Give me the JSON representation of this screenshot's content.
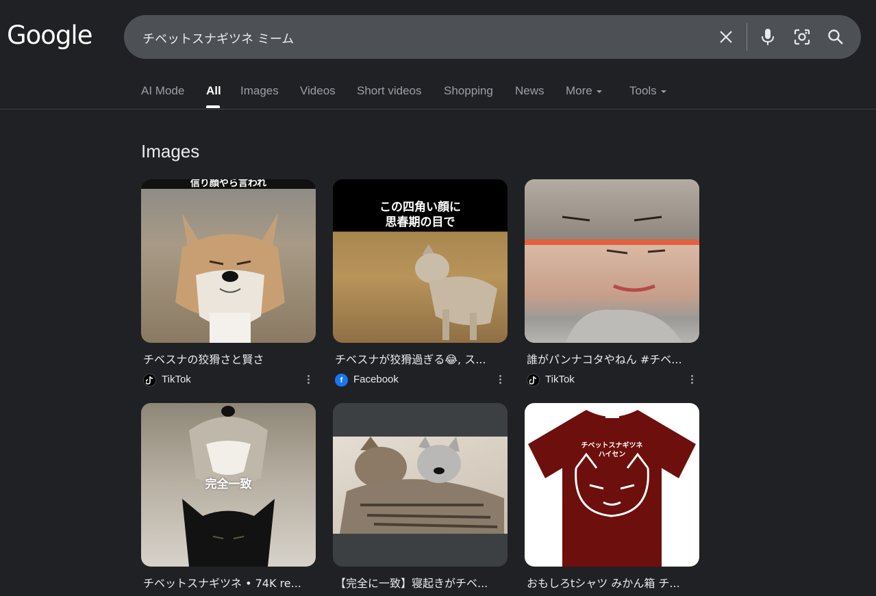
{
  "logo": "Google",
  "search": {
    "query": "チベットスナギツネ ミーム"
  },
  "tabs": [
    {
      "label": "AI Mode"
    },
    {
      "label": "All"
    },
    {
      "label": "Images"
    },
    {
      "label": "Videos"
    },
    {
      "label": "Short videos"
    },
    {
      "label": "Shopping"
    },
    {
      "label": "News"
    },
    {
      "label": "More"
    },
    {
      "label": "Tools"
    }
  ],
  "section_title": "Images",
  "cards": [
    {
      "caption": "チベスナの狡猾さと賢さ",
      "source": "TikTok",
      "overlay": "信り顔やら言われ"
    },
    {
      "caption": "チベスナが狡猾過ぎる😂, ス...",
      "source": "Facebook",
      "overlay": "この四角い顔に\n思春期の目で"
    },
    {
      "caption": "誰がパンナコタやねん #チベ...",
      "source": "TikTok",
      "overlay": ""
    },
    {
      "caption": "チベットスナギツネ • 74K re...",
      "source": "",
      "overlay": "完全一致"
    },
    {
      "caption": "【完全に一致】寝起きがチベ...",
      "source": "",
      "overlay": ""
    },
    {
      "caption": "おもしろtシャツ みかん箱 チ...",
      "source": "",
      "overlay": "チベットスナギツネ\nハイセン"
    }
  ],
  "colors": {
    "background": "#202124",
    "search_bg": "#4d5156",
    "tiktok": "#000000",
    "facebook": "#1877f2"
  }
}
